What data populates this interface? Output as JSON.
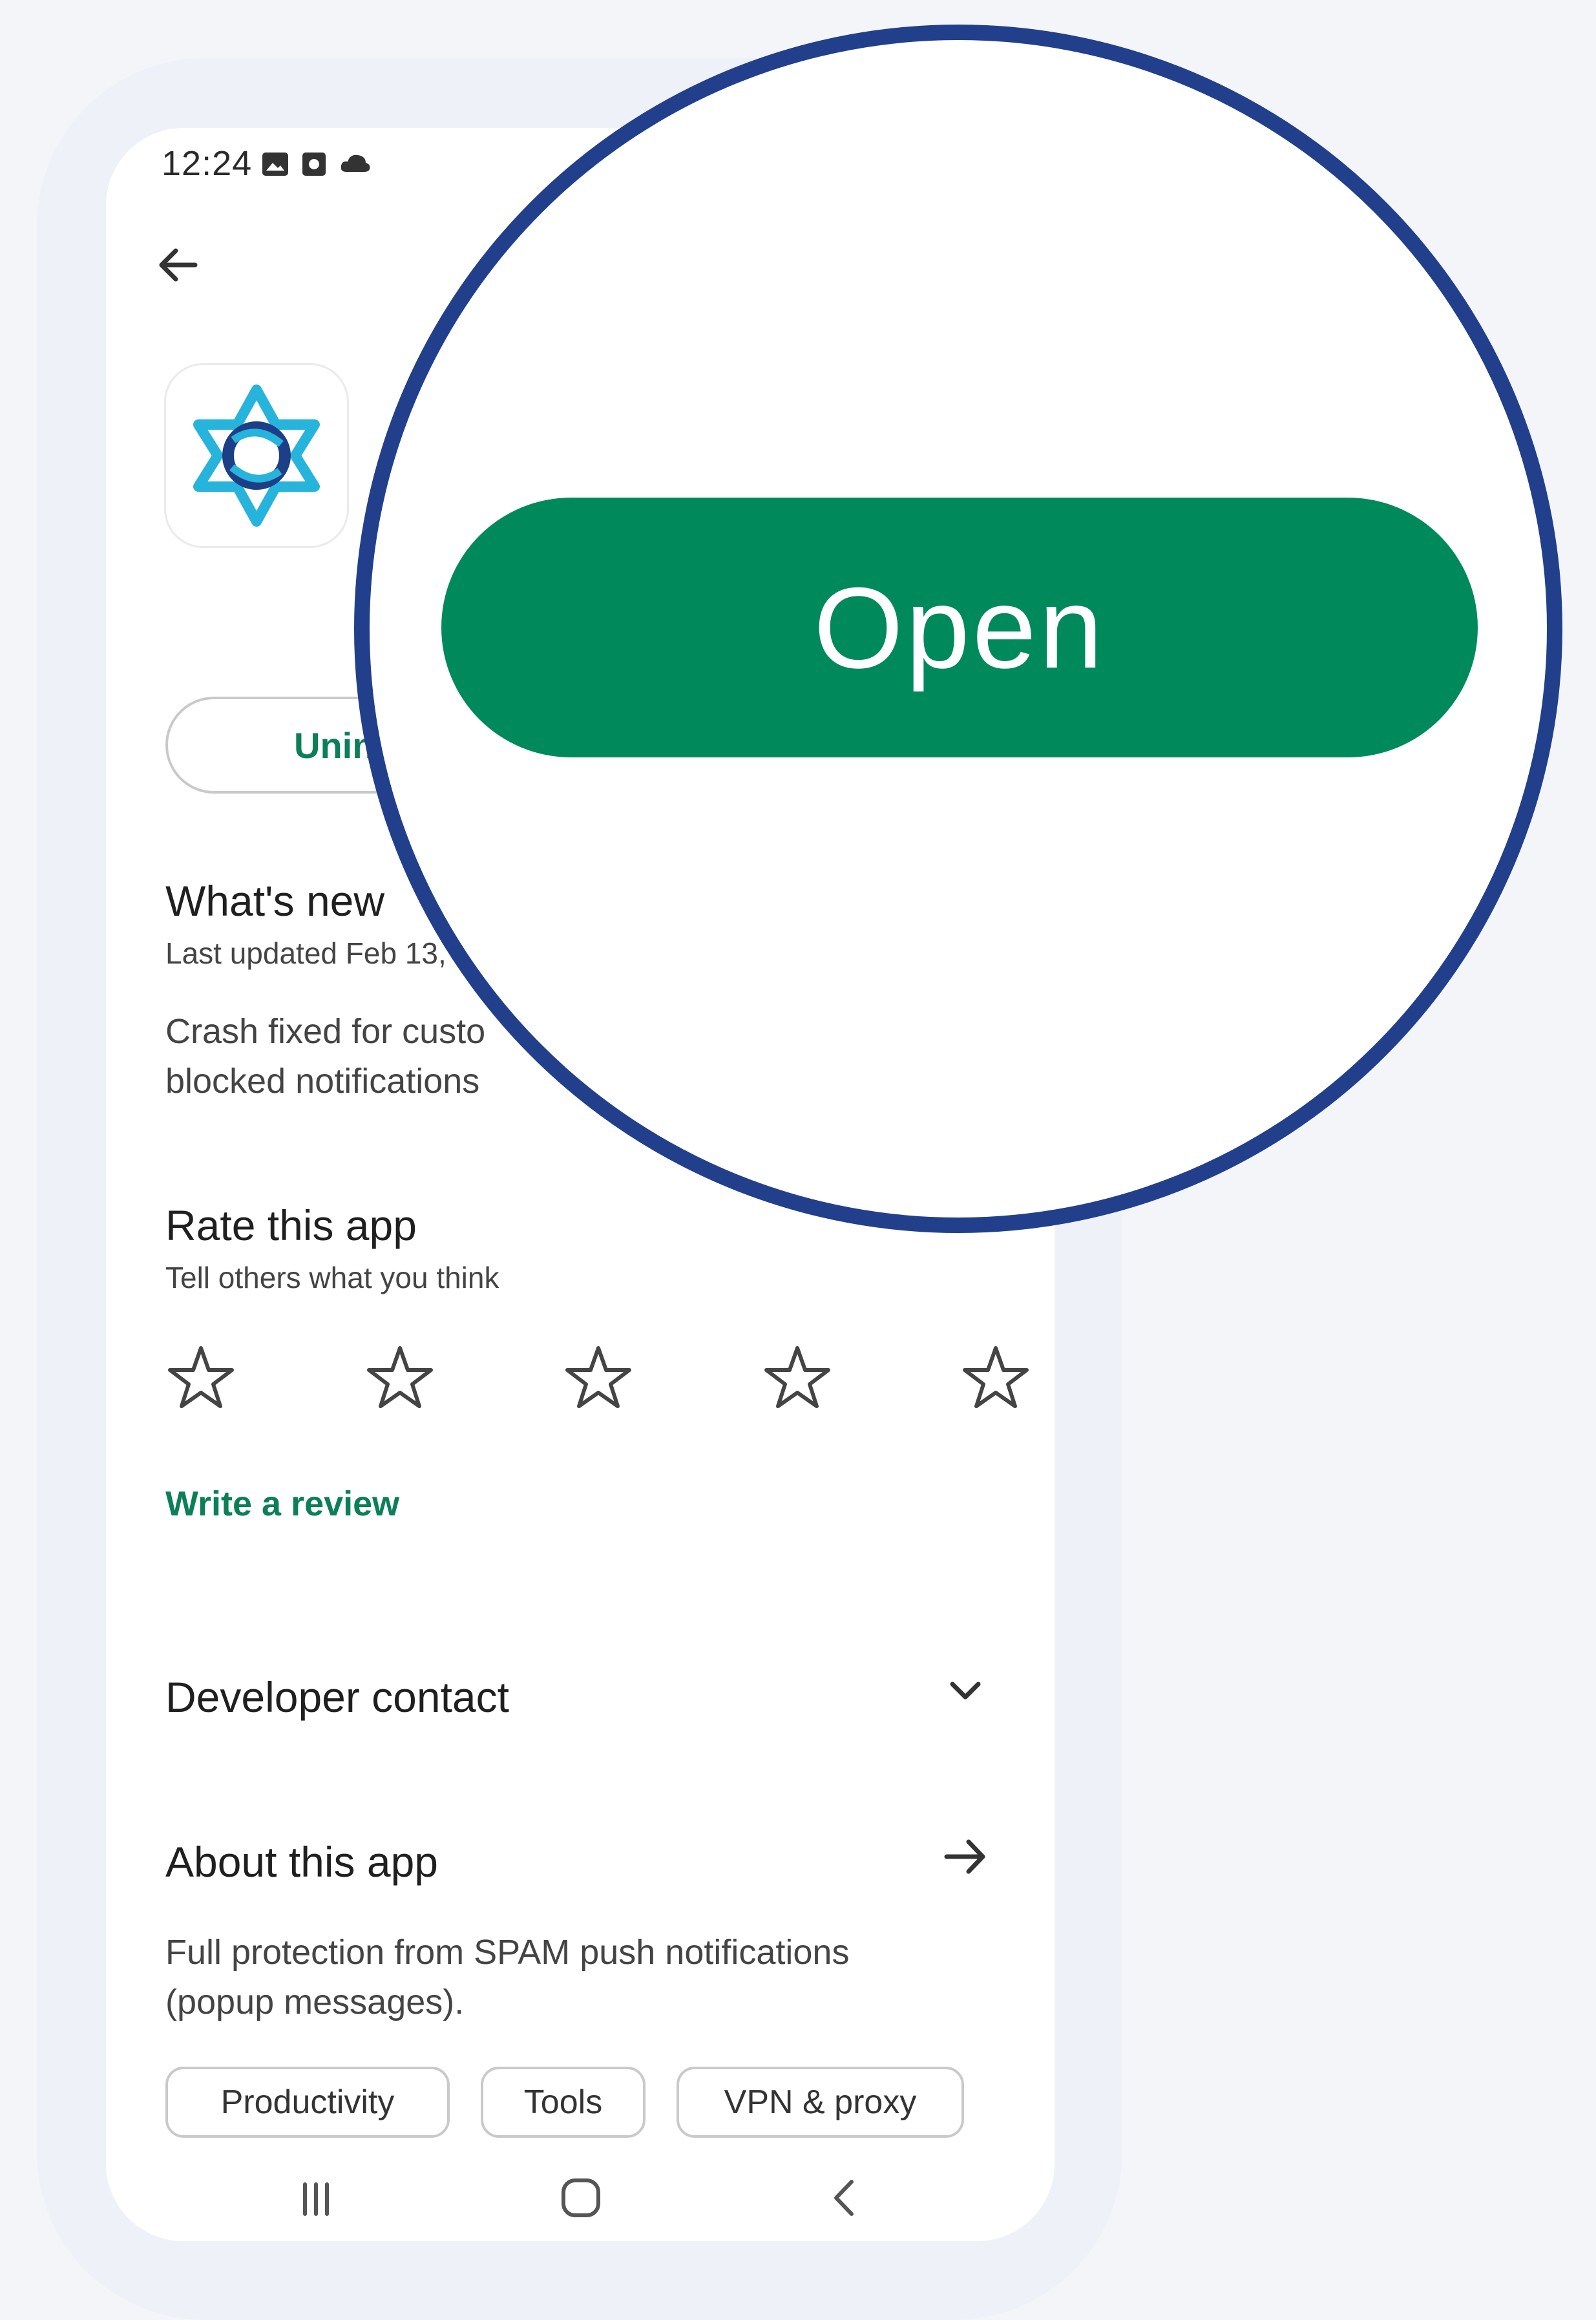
{
  "status_bar": {
    "time": "12:24",
    "icons": [
      "image-icon",
      "photo-icon",
      "cloud-icon"
    ]
  },
  "app": {
    "icon_name": "star-logo-icon",
    "uninstall_label": "Unin",
    "open_label": "Open"
  },
  "whats_new": {
    "title": "What's new",
    "last_updated": "Last updated Feb 13,",
    "body": [
      "Crash fixed for custo",
      "blocked notifications"
    ]
  },
  "rate": {
    "title": "Rate this app",
    "subtitle": "Tell others what you think",
    "stars_count": 5,
    "write_review": "Write a review"
  },
  "developer_contact": {
    "title": "Developer contact"
  },
  "about": {
    "title": "About this app",
    "body": [
      "Full protection from SPAM push notifications",
      "(popup messages)."
    ]
  },
  "categories": [
    "Productivity",
    "Tools",
    "VPN & proxy"
  ],
  "nav": {
    "icons": [
      "recents-icon",
      "home-icon",
      "back-icon"
    ]
  },
  "colors": {
    "accent_green": "#008a5b",
    "magnifier_border": "#223f8c",
    "link_green": "#0b7f56"
  }
}
